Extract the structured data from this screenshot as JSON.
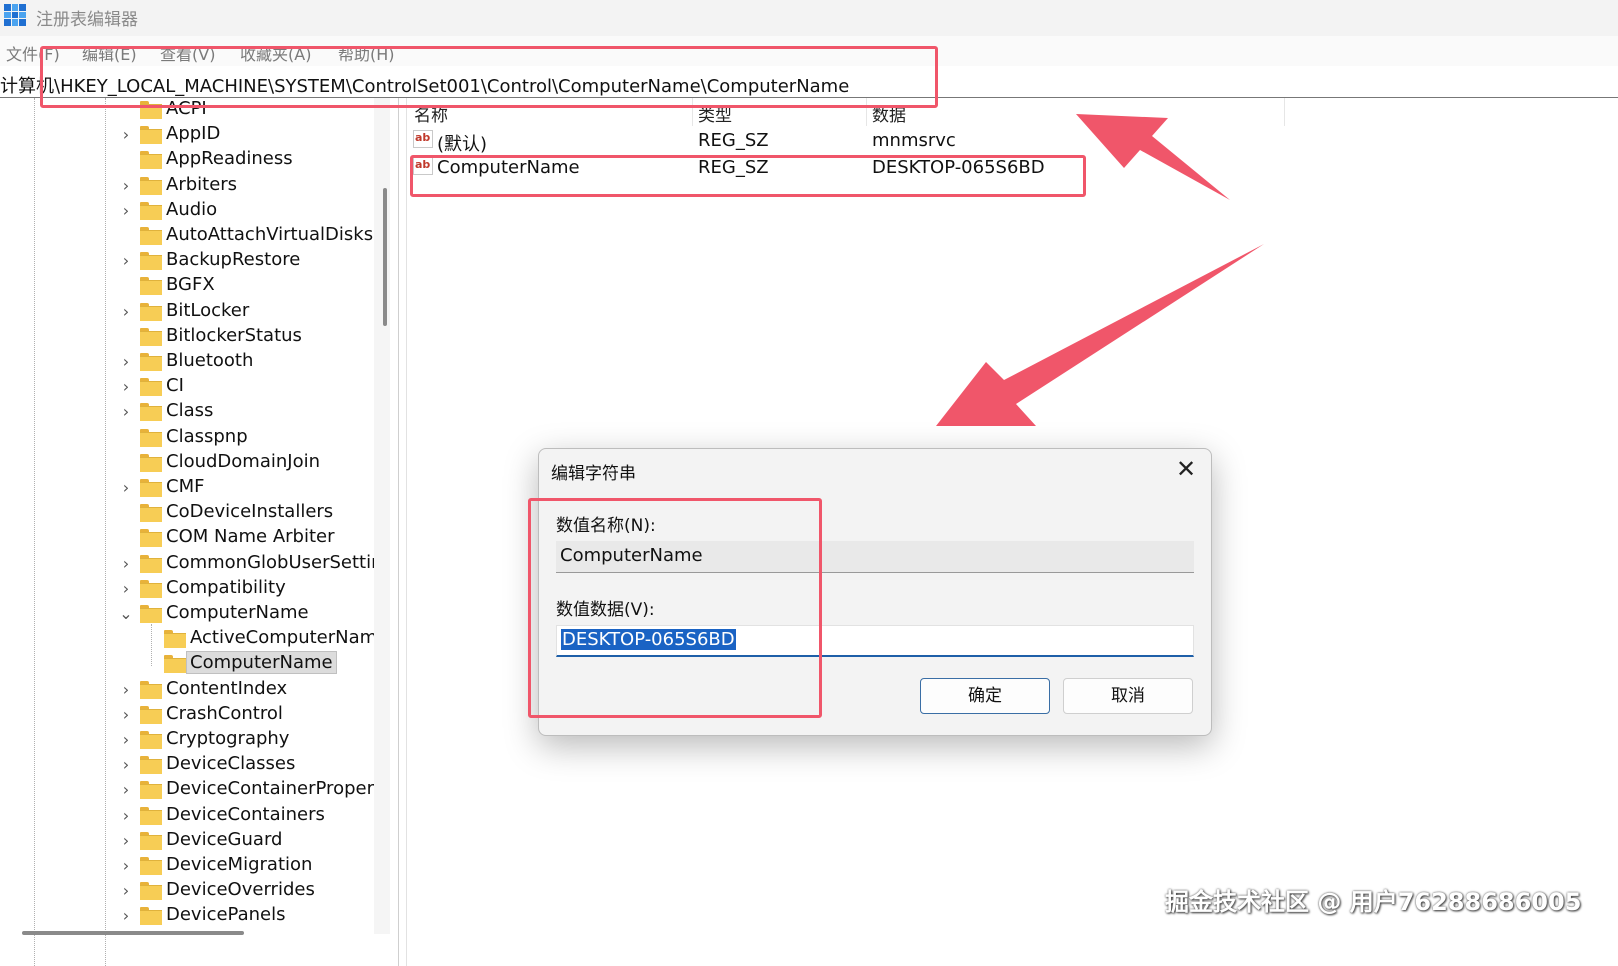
{
  "window": {
    "title": "注册表编辑器"
  },
  "menu": [
    "文件(F)",
    "编辑(E)",
    "查看(V)",
    "收藏夹(A)",
    "帮助(H)"
  ],
  "address": "计算机\\HKEY_LOCAL_MACHINE\\SYSTEM\\ControlSet001\\Control\\ComputerName\\ComputerName",
  "tree": [
    {
      "label": "ACPI",
      "expander": "none"
    },
    {
      "label": "AppID",
      "expander": "collapsed"
    },
    {
      "label": "AppReadiness",
      "expander": "none"
    },
    {
      "label": "Arbiters",
      "expander": "collapsed"
    },
    {
      "label": "Audio",
      "expander": "collapsed"
    },
    {
      "label": "AutoAttachVirtualDisks",
      "expander": "none"
    },
    {
      "label": "BackupRestore",
      "expander": "collapsed"
    },
    {
      "label": "BGFX",
      "expander": "none"
    },
    {
      "label": "BitLocker",
      "expander": "collapsed"
    },
    {
      "label": "BitlockerStatus",
      "expander": "none"
    },
    {
      "label": "Bluetooth",
      "expander": "collapsed"
    },
    {
      "label": "CI",
      "expander": "collapsed"
    },
    {
      "label": "Class",
      "expander": "collapsed"
    },
    {
      "label": "Classpnp",
      "expander": "none"
    },
    {
      "label": "CloudDomainJoin",
      "expander": "none"
    },
    {
      "label": "CMF",
      "expander": "collapsed"
    },
    {
      "label": "CoDeviceInstallers",
      "expander": "none"
    },
    {
      "label": "COM Name Arbiter",
      "expander": "none"
    },
    {
      "label": "CommonGlobUserSettings",
      "expander": "collapsed"
    },
    {
      "label": "Compatibility",
      "expander": "collapsed"
    },
    {
      "label": "ComputerName",
      "expander": "expanded"
    },
    {
      "label": "ActiveComputerName",
      "expander": "none",
      "child": true
    },
    {
      "label": "ComputerName",
      "expander": "none",
      "child": true,
      "selected": true
    },
    {
      "label": "ContentIndex",
      "expander": "collapsed"
    },
    {
      "label": "CrashControl",
      "expander": "collapsed"
    },
    {
      "label": "Cryptography",
      "expander": "collapsed"
    },
    {
      "label": "DeviceClasses",
      "expander": "collapsed"
    },
    {
      "label": "DeviceContainerPropertyUpdateEvents",
      "expander": "collapsed"
    },
    {
      "label": "DeviceContainers",
      "expander": "collapsed"
    },
    {
      "label": "DeviceGuard",
      "expander": "collapsed"
    },
    {
      "label": "DeviceMigration",
      "expander": "collapsed"
    },
    {
      "label": "DeviceOverrides",
      "expander": "collapsed"
    },
    {
      "label": "DevicePanels",
      "expander": "collapsed"
    }
  ],
  "columns": {
    "name": "名称",
    "type": "类型",
    "data": "数据"
  },
  "values": [
    {
      "name": "(默认)",
      "type": "REG_SZ",
      "data": "mnmsrvc",
      "icon": "string-value-icon"
    },
    {
      "name": "ComputerName",
      "type": "REG_SZ",
      "data": "DESKTOP-065S6BD",
      "icon": "string-value-icon"
    }
  ],
  "dialog": {
    "title": "编辑字符串",
    "close_glyph": "✕",
    "name_label": "数值名称(N):",
    "name_value": "ComputerName",
    "data_label": "数值数据(V):",
    "data_value": "DESKTOP-065S6BD",
    "ok_label": "确定",
    "cancel_label": "取消"
  },
  "watermark": "掘金技术社区 @ 用户76288686005",
  "colors": {
    "annotation": "#f0566a",
    "selection": "#1a63c4",
    "folder": "#f7cd55"
  }
}
